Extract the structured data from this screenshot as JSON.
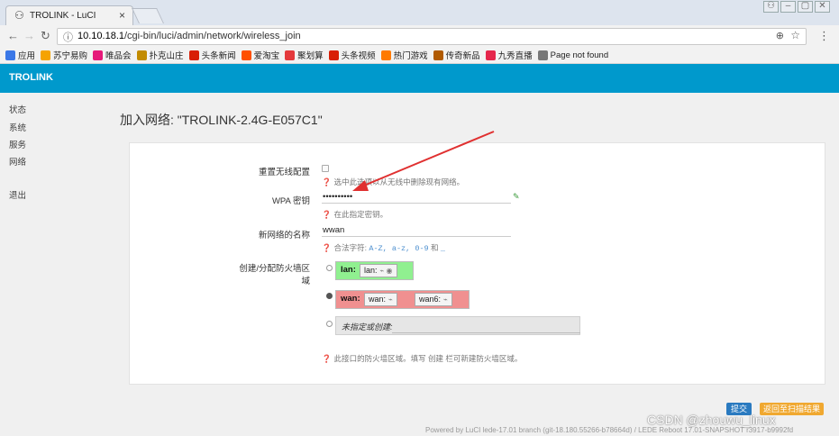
{
  "browser": {
    "tab_title": "TROLINK - LuCI",
    "tab_close": "×",
    "url_host": "10.10.18.1",
    "url_path": "/cgi-bin/luci/admin/network/wireless_join",
    "info_icon": "ⓘ",
    "zoom_icon": "🔍",
    "bookmarks": [
      {
        "label": "应用",
        "icon": "apps-icon",
        "color": "#3b78e7"
      },
      {
        "label": "苏宁易购",
        "icon": "suning-icon",
        "color": "#f5a300"
      },
      {
        "label": "唯品会",
        "icon": "vip-icon",
        "color": "#e6197a"
      },
      {
        "label": "扑克山庄",
        "icon": "poker-icon",
        "color": "#c28b00"
      },
      {
        "label": "头条新闻",
        "icon": "news-icon",
        "color": "#d81e06"
      },
      {
        "label": "爱淘宝",
        "icon": "taobao-icon",
        "color": "#ff5000"
      },
      {
        "label": "聚划算",
        "icon": "juhuasuan-icon",
        "color": "#e4393c"
      },
      {
        "label": "头条视频",
        "icon": "video-icon",
        "color": "#d81e06"
      },
      {
        "label": "热门游戏",
        "icon": "game-icon",
        "color": "#ff7a00"
      },
      {
        "label": "传奇新品",
        "icon": "legend-icon",
        "color": "#b05a00"
      },
      {
        "label": "九秀直播",
        "icon": "live-icon",
        "color": "#e5264b"
      },
      {
        "label": "Page not found",
        "icon": "page-icon",
        "color": "#777777"
      }
    ]
  },
  "app": {
    "brand": "TROLINK",
    "accent": "#0099cc",
    "sidebar": [
      "状态",
      "系统",
      "服务",
      "网络",
      "退出"
    ],
    "title": "加入网络: \"TROLINK-2.4G-E057C1\"",
    "form": {
      "reset_label": "重置无线配置",
      "reset_hint": "选中此选项以从无线中删除现有网络。",
      "wpa_label": "WPA 密钥",
      "wpa_value": "••••••••••",
      "wpa_hint": "在此指定密钥。",
      "name_label": "新网络的名称",
      "name_value": "wwan",
      "name_hint_prefix": "合法字符:",
      "name_hint_ranges": "A-Z, a-z, 0-9",
      "name_hint_and": "和",
      "name_hint_underscore": "_",
      "zone_label": "创建/分配防火墙区域",
      "zones": [
        {
          "name": "lan:",
          "color": "#90f090",
          "ifaces": [
            "lan:"
          ]
        },
        {
          "name": "wan:",
          "color": "#f09090",
          "ifaces": [
            "wan:",
            "wan6:"
          ]
        }
      ],
      "unspecified_label": "未指定或创建:",
      "zone_hint": "此接口的防火墙区域。填写 创建 栏可新建防火墙区域。"
    },
    "buttons": {
      "submit": "提交",
      "back": "返回至扫描结果"
    },
    "footer": "Powered by LuCI lede-17.01 branch (git-18.180.55266-b78664d) / LEDE Reboot 17.01-SNAPSHOT r3917-b9992fd"
  },
  "watermark": "CSDN @zhouwu_linux"
}
